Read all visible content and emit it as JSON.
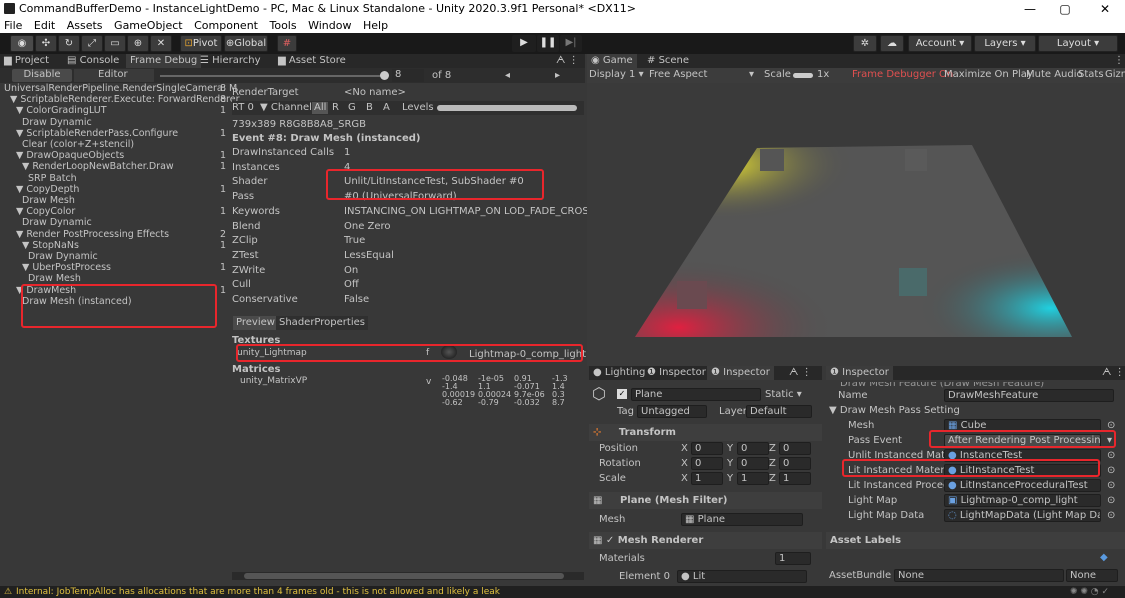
{
  "window": {
    "title": "CommandBufferDemo - InstanceLightDemo - PC, Mac & Linux Standalone - Unity 2020.3.9f1 Personal* <DX11>",
    "minimize": "—",
    "maximize": "▢",
    "close": "✕"
  },
  "menu": [
    "File",
    "Edit",
    "Assets",
    "GameObject",
    "Component",
    "Tools",
    "Window",
    "Help"
  ],
  "toolbar": {
    "pivot": "Pivot",
    "global": "Global",
    "account": "Account ▾",
    "layers": "Layers ▾",
    "layout": "Layout ▾"
  },
  "left_tabs": [
    "Project",
    "Console",
    "Frame Debug",
    "Hierarchy",
    "Asset Store"
  ],
  "frame_debug": {
    "disable": "Disable",
    "editor": "Editor",
    "slider_value": "8",
    "of": "of 8",
    "tree": [
      {
        "label": "UniversalRenderPipeline.RenderSingleCamera: M",
        "count": "8",
        "indent": 0
      },
      {
        "label": "▼ ScriptableRenderer.Execute: ForwardRenderer",
        "count": "8",
        "indent": 1
      },
      {
        "label": "▼ ColorGradingLUT",
        "count": "1",
        "indent": 2
      },
      {
        "label": "Draw Dynamic",
        "count": "",
        "indent": 3
      },
      {
        "label": "▼ ScriptableRenderPass.Configure",
        "count": "1",
        "indent": 2
      },
      {
        "label": "Clear (color+Z+stencil)",
        "count": "",
        "indent": 3
      },
      {
        "label": "▼ DrawOpaqueObjects",
        "count": "1",
        "indent": 2
      },
      {
        "label": "▼ RenderLoopNewBatcher.Draw",
        "count": "1",
        "indent": 3
      },
      {
        "label": "SRP Batch",
        "count": "",
        "indent": 4
      },
      {
        "label": "▼ CopyDepth",
        "count": "1",
        "indent": 2
      },
      {
        "label": "Draw Mesh",
        "count": "",
        "indent": 3
      },
      {
        "label": "▼ CopyColor",
        "count": "1",
        "indent": 2
      },
      {
        "label": "Draw Dynamic",
        "count": "",
        "indent": 3
      },
      {
        "label": "▼ Render PostProcessing Effects",
        "count": "2",
        "indent": 2
      },
      {
        "label": "▼ StopNaNs",
        "count": "1",
        "indent": 3
      },
      {
        "label": "Draw Dynamic",
        "count": "",
        "indent": 4
      },
      {
        "label": "▼ UberPostProcess",
        "count": "1",
        "indent": 3
      },
      {
        "label": "Draw Mesh",
        "count": "",
        "indent": 4
      },
      {
        "label": "▼ DrawMesh",
        "count": "1",
        "indent": 2
      },
      {
        "label": "Draw Mesh (instanced)",
        "count": "",
        "indent": 3
      }
    ],
    "render_target_label": "RenderTarget",
    "render_target_value": "<No name>",
    "rt": "RT 0",
    "channels": "▼ Channels",
    "all": "All",
    "r": "R",
    "g": "G",
    "b": "B",
    "a": "A",
    "levels": "Levels",
    "format": "739x389 R8G8B8A8_SRGB",
    "event_title": "Event #8: Draw Mesh (instanced)",
    "props": [
      {
        "k": "DrawInstanced Calls",
        "v": "1"
      },
      {
        "k": "Instances",
        "v": "4"
      },
      {
        "k": "Shader",
        "v": "Unlit/LitInstanceTest, SubShader #0"
      },
      {
        "k": "Pass",
        "v": "#0 (UniversalForward)"
      },
      {
        "k": "Keywords",
        "v": "INSTANCING_ON LIGHTMAP_ON LOD_FADE_CROSSFADE"
      },
      {
        "k": "Blend",
        "v": "One Zero"
      },
      {
        "k": "ZClip",
        "v": "True"
      },
      {
        "k": "ZTest",
        "v": "LessEqual"
      },
      {
        "k": "ZWrite",
        "v": "On"
      },
      {
        "k": "Cull",
        "v": "Off"
      },
      {
        "k": "Conservative",
        "v": "False"
      }
    ],
    "preview": "Preview",
    "shader_props": "ShaderProperties",
    "textures": "Textures",
    "tex_name": "unity_Lightmap",
    "tex_type": "f",
    "tex_value": "Lightmap-0_comp_light",
    "matrices": "Matrices",
    "mat_name": "unity_MatrixVP",
    "mat_type": "v",
    "matrix": [
      [
        "-0.048",
        "-1e-05",
        "0.91",
        "-1.3"
      ],
      [
        "-1.4",
        "1.1",
        "-0.071",
        "1.4"
      ],
      [
        "0.00019",
        "0.00024",
        "9.7e-06",
        "0.3"
      ],
      [
        "-0.62",
        "-0.79",
        "-0.032",
        "8.7"
      ]
    ]
  },
  "game": {
    "tab_game": "Game",
    "tab_scene": "Scene",
    "display": "Display 1 ▾",
    "aspect": "Free Aspect",
    "scale": "Scale",
    "scale_value": "1x",
    "fd_on": "Frame Debugger On",
    "maximize": "Maximize On Play",
    "mute": "Mute Audio",
    "stats": "Stats",
    "gizmos": "Gizm"
  },
  "inspector_mid": {
    "tabs": [
      "Lighting",
      "Inspector",
      "Inspector"
    ],
    "object_name": "Plane",
    "static": "Static ▾",
    "tag_label": "Tag",
    "tag": "Untagged",
    "layer_label": "Layer",
    "layer": "Default",
    "transform": "Transform",
    "rows": [
      {
        "k": "Position",
        "x": "0",
        "y": "0",
        "z": "0"
      },
      {
        "k": "Rotation",
        "x": "0",
        "y": "0",
        "z": "0"
      },
      {
        "k": "Scale",
        "x": "1",
        "y": "1",
        "z": "1"
      }
    ],
    "mesh_filter": "Plane (Mesh Filter)",
    "mesh_label": "Mesh",
    "mesh_value": "Plane",
    "mesh_renderer": "Mesh Renderer",
    "materials": "Materials",
    "materials_count": "1",
    "element0": "Element 0",
    "element0_value": "Lit"
  },
  "inspector_right": {
    "tab": "Inspector",
    "clipped_header": "Draw Mesh Feature (Draw Mesh Feature)",
    "name_label": "Name",
    "name_value": "DrawMeshFeature",
    "section": "▼ Draw Mesh Pass Setting",
    "rows": [
      {
        "k": "Mesh",
        "v": "Cube"
      },
      {
        "k": "Pass Event",
        "v": "After Rendering Post Processing"
      },
      {
        "k": "Unlit Instanced Materi",
        "v": "InstanceTest"
      },
      {
        "k": "Lit Instanced Material",
        "v": "LitInstanceTest"
      },
      {
        "k": "Lit Instanced Procedu",
        "v": "LitInstanceProceduralTest"
      },
      {
        "k": "Light Map",
        "v": "Lightmap-0_comp_light"
      },
      {
        "k": "Light Map Data",
        "v": "LightMapData (Light Map Data)"
      }
    ],
    "asset_labels": "Asset Labels",
    "assetbundle": "AssetBundle",
    "ab_value": "None",
    "ab_variant": "None"
  },
  "status": {
    "warning": "Internal: JobTempAlloc has allocations that are more than 4 frames old - this is not allowed and likely a leak"
  },
  "colors": {
    "highlight": "#e8262c",
    "selection": "#2c5d87",
    "fd_on": "#e05050"
  }
}
